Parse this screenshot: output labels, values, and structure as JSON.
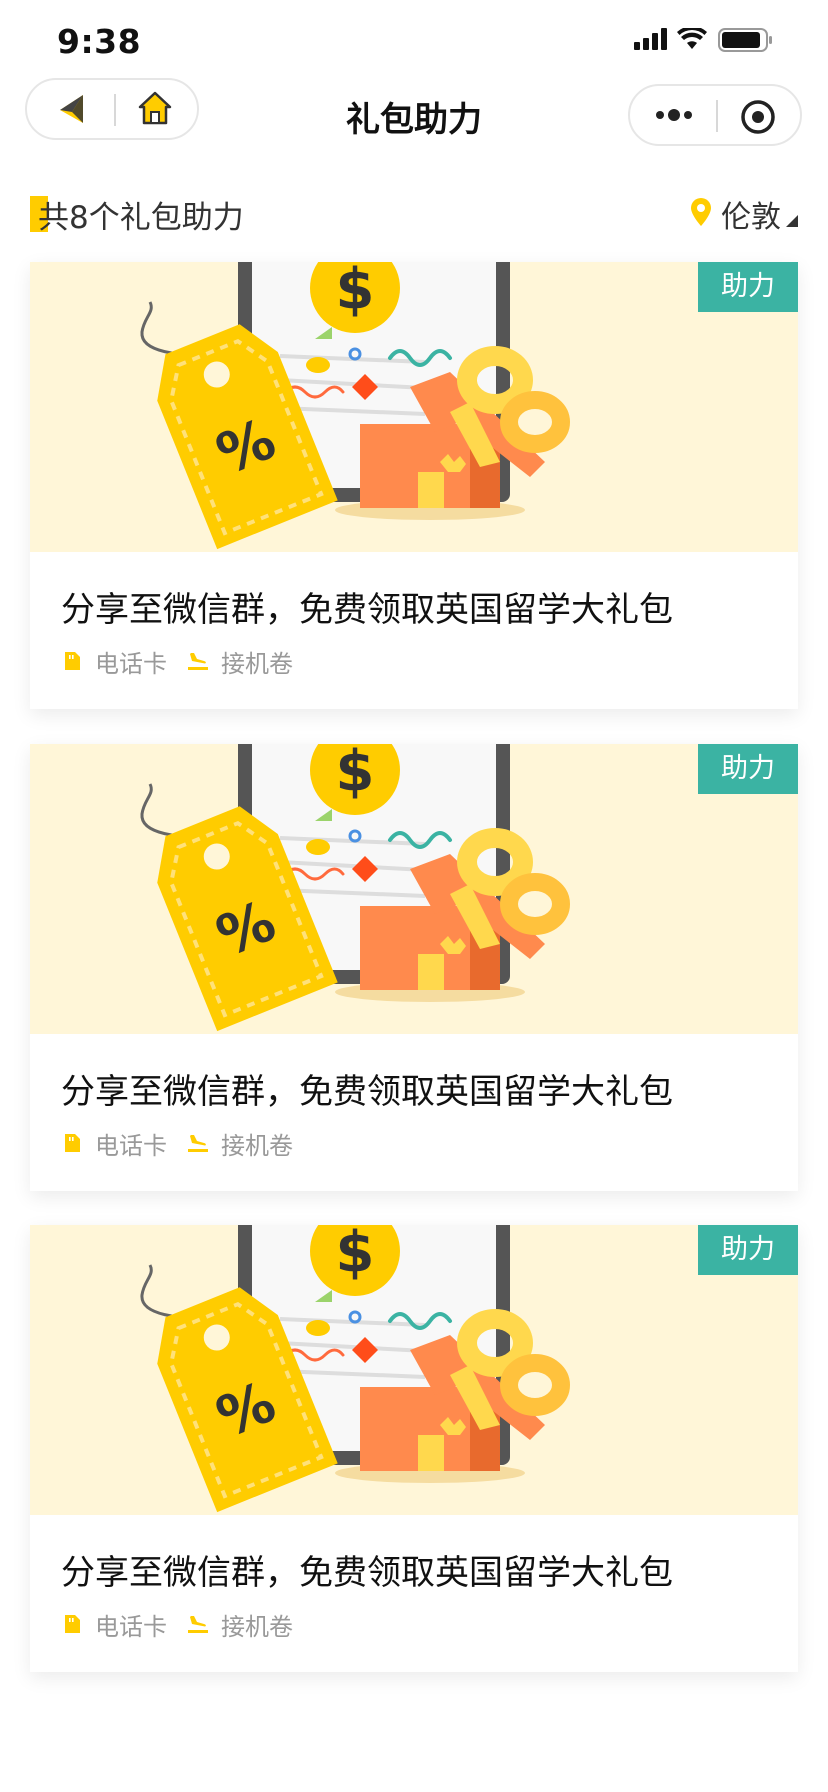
{
  "status_bar": {
    "time": "9:38"
  },
  "nav": {
    "title": "礼包助力"
  },
  "summary": {
    "count_text": "共8个礼包助力",
    "location": "伦敦"
  },
  "colors": {
    "accent": "#ffcc00",
    "badge": "#3bb3a3",
    "banner_bg": "#fff6d8"
  },
  "cards": [
    {
      "badge": "助力",
      "title": "分享至微信群，免费领取英国留学大礼包",
      "tags": [
        {
          "icon": "sim-card-icon",
          "label": "电话卡"
        },
        {
          "icon": "plane-landing-icon",
          "label": "接机卷"
        }
      ]
    },
    {
      "badge": "助力",
      "title": "分享至微信群，免费领取英国留学大礼包",
      "tags": [
        {
          "icon": "sim-card-icon",
          "label": "电话卡"
        },
        {
          "icon": "plane-landing-icon",
          "label": "接机卷"
        }
      ]
    },
    {
      "badge": "助力",
      "title": "分享至微信群，免费领取英国留学大礼包",
      "tags": [
        {
          "icon": "sim-card-icon",
          "label": "电话卡"
        },
        {
          "icon": "plane-landing-icon",
          "label": "接机卷"
        }
      ]
    }
  ]
}
